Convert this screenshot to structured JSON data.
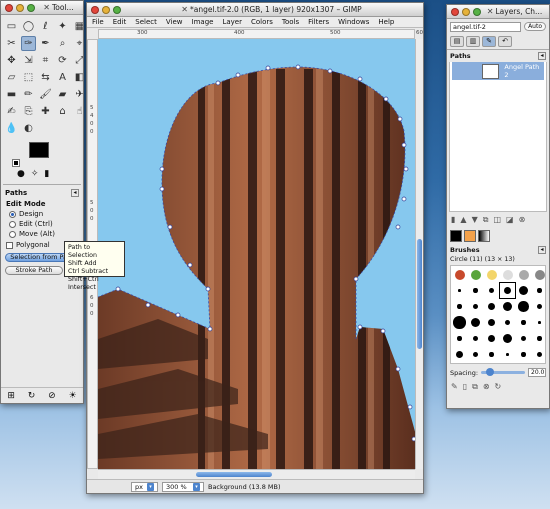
{
  "toolbox": {
    "title": "Tool...",
    "tools": [
      "rect-select-icon",
      "ellipse-select-icon",
      "lasso-icon",
      "fuzzy-select-icon",
      "select-by-color-icon",
      "scissors-icon",
      "paths-icon",
      "color-picker-icon",
      "zoom-icon",
      "measure-icon",
      "move-icon",
      "align-icon",
      "crop-icon",
      "rotate-icon",
      "scale-icon",
      "shear-icon",
      "perspective-icon",
      "flip-icon",
      "text-icon",
      "bucket-fill-icon",
      "blend-icon",
      "pencil-icon",
      "paintbrush-icon",
      "eraser-icon",
      "airbrush-icon",
      "ink-icon",
      "clone-icon",
      "heal-icon",
      "perspective-clone-icon",
      "smudge-icon",
      "blur-icon",
      "dodge-burn-icon"
    ],
    "colors": {
      "foreground": "#000000",
      "background": "#ffffff"
    },
    "paths_label": "Paths",
    "edit_mode_label": "Edit Mode",
    "modes": [
      "Design",
      "Edit (Ctrl)",
      "Move (Alt)"
    ],
    "selected_mode": "Design",
    "polygonal_label": "Polygonal",
    "selection_button": "Selection from Path",
    "stroke_button": "Stroke Path"
  },
  "tooltip": {
    "lines": [
      "Path to Selection",
      "Shift  Add",
      "Ctrl  Subtract",
      "Shift+Ctrl  Intersect"
    ]
  },
  "image_window": {
    "title": "*angel.tif-2.0 (RGB, 1 layer) 920x1307 – GIMP",
    "menus": [
      "File",
      "Edit",
      "Select",
      "View",
      "Image",
      "Layer",
      "Colors",
      "Tools",
      "Filters",
      "Windows",
      "Help"
    ],
    "ruler_top": [
      "300",
      "400",
      "500",
      "600"
    ],
    "ruler_left": [
      "5",
      "4",
      "0",
      "0",
      "5",
      "0",
      "0",
      "6",
      "0",
      "0"
    ],
    "unit": "px",
    "zoom": "300 %",
    "status": "Background (13.8 MB)",
    "sky_color": "#86c8ee"
  },
  "layers_window": {
    "title": "Layers, Ch...",
    "image_combo": "angel.tif-2",
    "auto_button": "Auto",
    "paths_header": "Paths",
    "path_name": "Angel Path 2",
    "brushes_header": "Brushes",
    "brush_info": "Circle (11) (13 × 13)",
    "spacing_label": "Spacing:",
    "spacing_value": "20.0",
    "spacing_fraction": 0.2
  }
}
